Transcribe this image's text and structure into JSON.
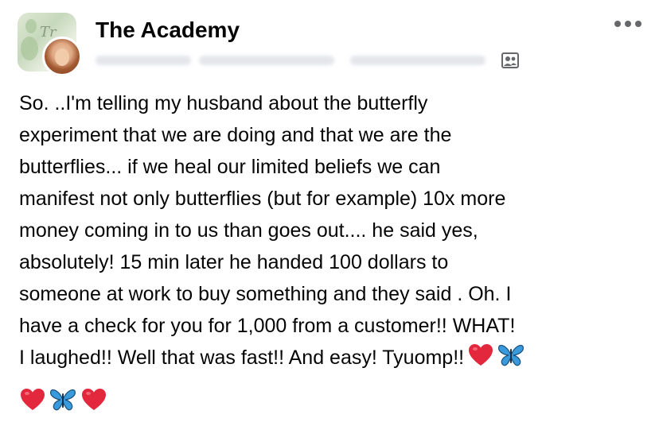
{
  "post": {
    "group_name": "The Academy",
    "group_photo_script": "Tr",
    "body_lines": [
      "So. ..I'm telling my husband about the butterfly",
      "experiment that we are doing and that we are the",
      "butterflies... if we heal our limited beliefs we can",
      "manifest not only butterflies (but for example) 10x more",
      "money coming in to us than goes out.... he said yes,",
      "absolutely! 15 min later he handed 100 dollars to",
      "someone at work to buy something and they said . Oh. I",
      "have a check for you for 1,000 from a customer!! WHAT!",
      "I laughed!! Well that was fast!! And easy! Tyuomp!!"
    ],
    "trailing_emojis_line9": [
      "heart-icon",
      "butterfly-icon"
    ],
    "final_emojis": [
      "heart-icon",
      "butterfly-icon",
      "heart-icon"
    ]
  },
  "icons": {
    "more": "more-options-icon",
    "privacy": "group-privacy-icon"
  },
  "colors": {
    "text": "#050505",
    "secondary": "#65676b",
    "heart": "#e3283e",
    "butterfly": "#3a9bdc"
  }
}
